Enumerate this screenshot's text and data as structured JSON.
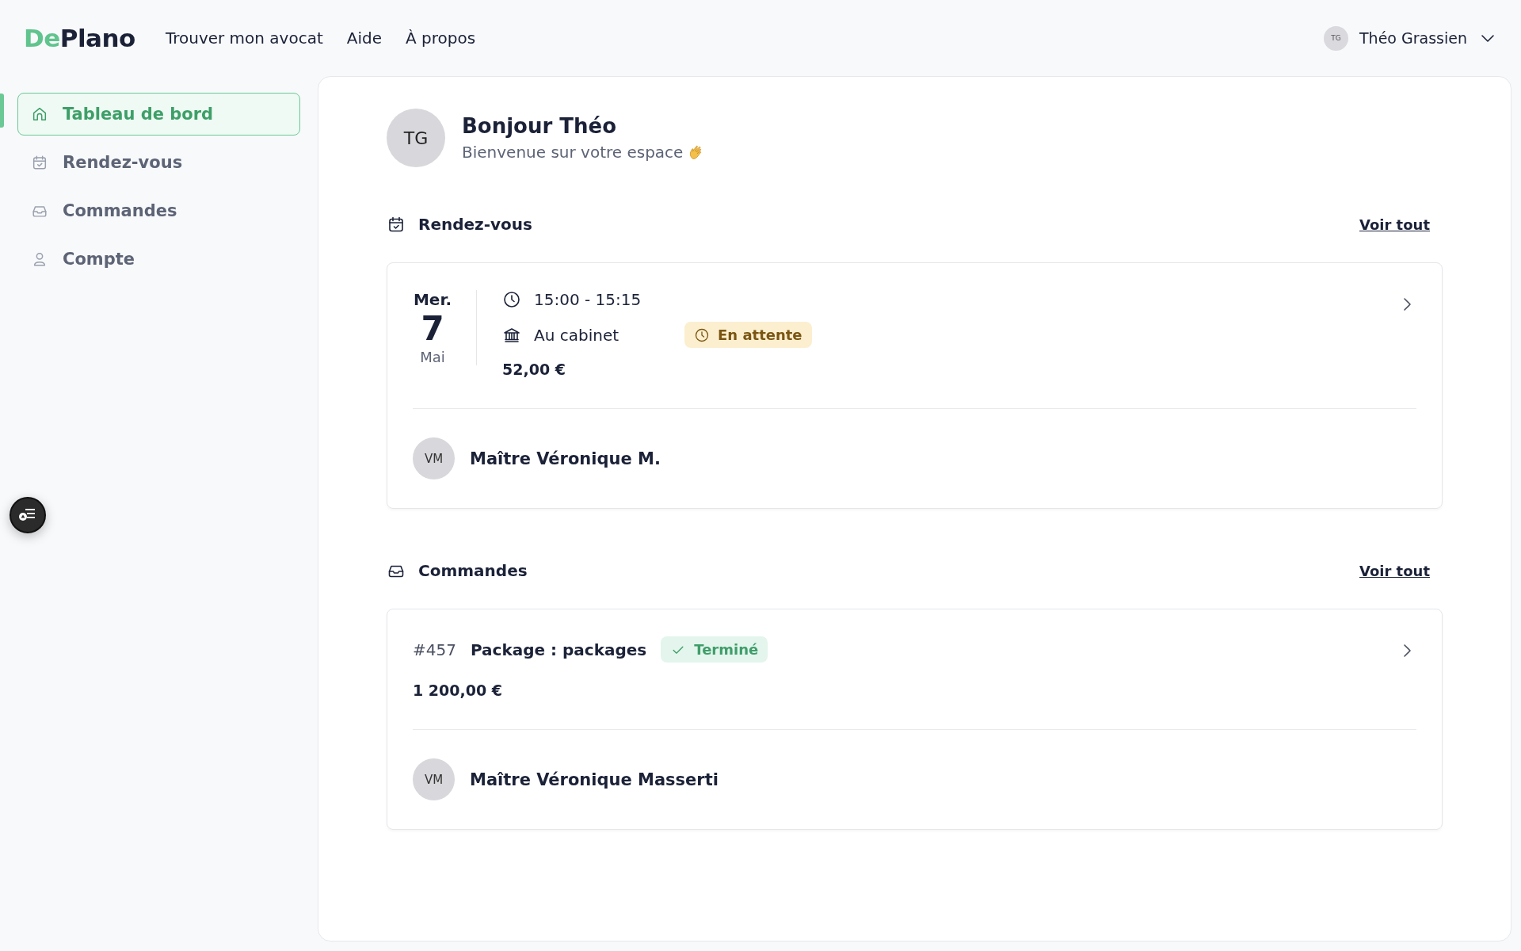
{
  "logo": {
    "part_1": "De",
    "part_2": "Plano"
  },
  "nav": [
    "Trouver mon avocat",
    "Aide",
    "À propos"
  ],
  "user": {
    "initials": "TG",
    "name": "Théo Grassien"
  },
  "sidebar": {
    "items": [
      {
        "kind": "home",
        "label": "Tableau de bord",
        "selected": true
      },
      {
        "kind": "calendar",
        "label": "Rendez-vous",
        "selected": false
      },
      {
        "kind": "inbox",
        "label": "Commandes",
        "selected": false
      },
      {
        "kind": "user",
        "label": "Compte",
        "selected": false
      }
    ]
  },
  "greeting": {
    "initials": "TG",
    "title": "Bonjour Théo",
    "subtitle": "Bienvenue sur votre espace"
  },
  "appointments": {
    "title": "Rendez-vous",
    "link": "Voir tout",
    "items": [
      {
        "day_name": "Mer.",
        "day": "7",
        "month": "Mai",
        "time": "15:00 - 15:15",
        "location": "Au cabinet",
        "price": "52,00 €",
        "status": {
          "kind": "pending",
          "label": "En attente"
        },
        "lawyer": {
          "initials": "VM",
          "name": "Maître Véronique M."
        }
      }
    ]
  },
  "orders": {
    "title": "Commandes",
    "link": "Voir tout",
    "items": [
      {
        "number": "#457",
        "title": "Package : packages",
        "status": {
          "kind": "done",
          "label": "Terminé"
        },
        "price": "1 200,00 €",
        "lawyer": {
          "initials": "VM",
          "name": "Maître Véronique Masserti"
        }
      }
    ]
  }
}
